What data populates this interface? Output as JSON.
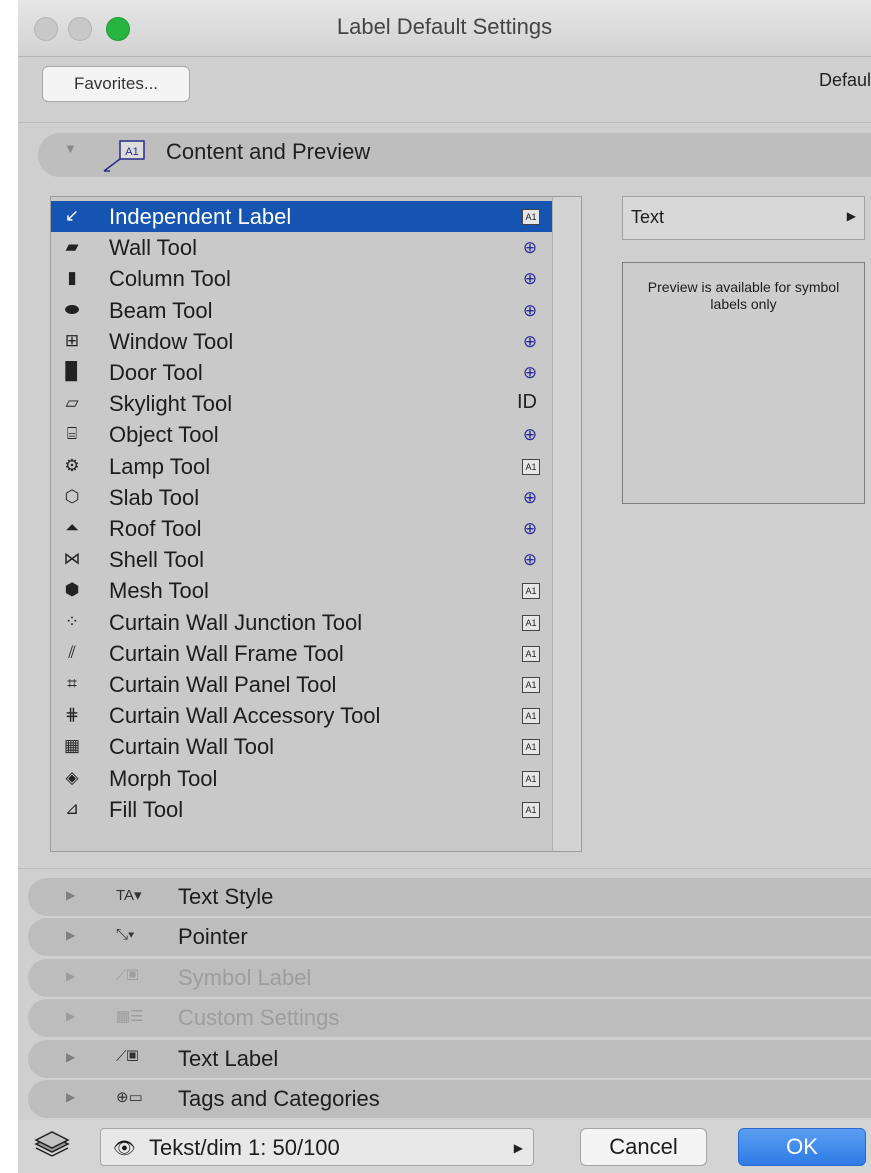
{
  "window": {
    "title": "Label Default Settings"
  },
  "toolbar": {
    "favorites_label": "Favorites...",
    "default_label": "Defaul"
  },
  "panels": {
    "content_preview": {
      "label": "Content and Preview"
    }
  },
  "tool_list": [
    {
      "label": "Independent Label",
      "icon": "independent-label-icon",
      "badge": "a1"
    },
    {
      "label": "Wall Tool",
      "icon": "wall-icon",
      "badge": "target"
    },
    {
      "label": "Column Tool",
      "icon": "column-icon",
      "badge": "target"
    },
    {
      "label": "Beam Tool",
      "icon": "beam-icon",
      "badge": "target"
    },
    {
      "label": "Window Tool",
      "icon": "window-icon",
      "badge": "target"
    },
    {
      "label": "Door Tool",
      "icon": "door-icon",
      "badge": "target"
    },
    {
      "label": "Skylight Tool",
      "icon": "skylight-icon",
      "badge": "ID"
    },
    {
      "label": "Object Tool",
      "icon": "object-icon",
      "badge": "target"
    },
    {
      "label": "Lamp Tool",
      "icon": "lamp-icon",
      "badge": "a1"
    },
    {
      "label": "Slab Tool",
      "icon": "slab-icon",
      "badge": "target"
    },
    {
      "label": "Roof Tool",
      "icon": "roof-icon",
      "badge": "target"
    },
    {
      "label": "Shell Tool",
      "icon": "shell-icon",
      "badge": "target"
    },
    {
      "label": "Mesh Tool",
      "icon": "mesh-icon",
      "badge": "a1"
    },
    {
      "label": "Curtain Wall Junction Tool",
      "icon": "curtain-wall-junction-icon",
      "badge": "a1"
    },
    {
      "label": "Curtain Wall Frame Tool",
      "icon": "curtain-wall-frame-icon",
      "badge": "a1"
    },
    {
      "label": "Curtain Wall Panel Tool",
      "icon": "curtain-wall-panel-icon",
      "badge": "a1"
    },
    {
      "label": "Curtain Wall Accessory Tool",
      "icon": "curtain-wall-accessory-icon",
      "badge": "a1"
    },
    {
      "label": "Curtain Wall Tool",
      "icon": "curtain-wall-icon",
      "badge": "a1"
    },
    {
      "label": "Morph Tool",
      "icon": "morph-icon",
      "badge": "a1"
    },
    {
      "label": "Fill Tool",
      "icon": "fill-icon",
      "badge": "a1"
    }
  ],
  "text_type_select": {
    "value": "Text"
  },
  "preview": {
    "message": "Preview is available for symbol labels only"
  },
  "collapsed_panels": [
    {
      "label": "Text Style",
      "icon_text": "TA▾",
      "enabled": true
    },
    {
      "label": "Pointer",
      "icon_text": "⤡▾",
      "enabled": true
    },
    {
      "label": "Symbol Label",
      "icon_text": "⟋▣",
      "enabled": false
    },
    {
      "label": "Custom Settings",
      "icon_text": "▦☰",
      "enabled": false
    },
    {
      "label": "Text Label",
      "icon_text": "⟋▣",
      "enabled": true
    },
    {
      "label": "Tags and Categories",
      "icon_text": "⊕▭",
      "enabled": true
    }
  ],
  "bottom": {
    "layer_value": "Tekst/dim 1: 50/100",
    "cancel_label": "Cancel",
    "ok_label": "OK"
  },
  "colors": {
    "selection": "#1554b0",
    "ok_button": "#2d7be5",
    "target_badge": "#2a2a9a"
  }
}
